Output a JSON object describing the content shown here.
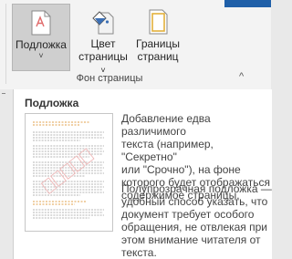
{
  "ribbon": {
    "buttons": {
      "watermark": {
        "label": "Подложка",
        "chevron": "˅",
        "icon": "watermark-icon"
      },
      "page_color": {
        "label_line1": "Цвет",
        "label_line2": "страницы",
        "chevron": "˅",
        "icon": "page-color-icon"
      },
      "page_borders": {
        "label_line1": "Границы",
        "label_line2": "страниц",
        "icon": "page-borders-icon"
      }
    },
    "group_label": "Фон страницы",
    "collapse_glyph": "^"
  },
  "tooltip": {
    "title": "Подложка",
    "paragraph1": "Добавление едва различимого\nтекста (например, \"Секретно\"\nили \"Срочно\"), на фоне\nкоторого будет отображаться\nсодержимое страницы.",
    "paragraph2": "Полупрозрачная подложка —\nудобный способ указать, что\nдокумент требует особого\nобращения, не отвлекая при\nэтом внимание читателя от\nтекста."
  },
  "colors": {
    "accent": "#1f5fa8",
    "watermark_icon": "#e06a6a",
    "paint_bucket": "#3b6fb5",
    "orange_lines": "#e2a04b"
  }
}
